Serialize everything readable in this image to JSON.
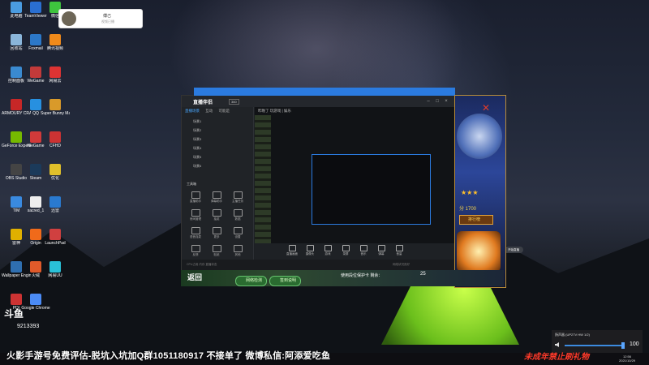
{
  "notification": {
    "name": "傅己",
    "sub": "视频已播"
  },
  "desktop_icons": [
    {
      "label": "此电脑",
      "color": "#4a9be0"
    },
    {
      "label": "TeamViewer",
      "color": "#2a6fd1"
    },
    {
      "label": "微信",
      "color": "#3ec43e"
    },
    {
      "label": "回收站",
      "color": "#8ab5d9"
    },
    {
      "label": "Foxmail",
      "color": "#2c78c8"
    },
    {
      "label": "腾讯视频",
      "color": "#f08a1a"
    },
    {
      "label": "控制面板",
      "color": "#3a8ad0"
    },
    {
      "label": "WeGame",
      "color": "#c23a3a"
    },
    {
      "label": "网易云",
      "color": "#d33"
    },
    {
      "label": "ARMOURY CRATE",
      "color": "#c72727"
    },
    {
      "label": "QQ",
      "color": "#2790e0"
    },
    {
      "label": "Super Bunny Man",
      "color": "#d99a2a"
    },
    {
      "label": "GeForce Experience",
      "color": "#76b900"
    },
    {
      "label": "WeGame",
      "color": "#d13a3a"
    },
    {
      "label": "CFHD",
      "color": "#c33"
    },
    {
      "label": "OBS Studio",
      "color": "#444"
    },
    {
      "label": "Steam",
      "color": "#1b3a5a"
    },
    {
      "label": "优化",
      "color": "#e0c02a"
    },
    {
      "label": "TIM",
      "color": "#3a8ae0"
    },
    {
      "label": "sacred_1",
      "color": "#eee"
    },
    {
      "label": "迅雷",
      "color": "#2a7ad0"
    },
    {
      "label": "雷神",
      "color": "#e0b000"
    },
    {
      "label": "Origin",
      "color": "#f06a1a"
    },
    {
      "label": "LaunchPad",
      "color": "#d04040"
    },
    {
      "label": "Wallpaper Engine",
      "color": "#2f6fb0"
    },
    {
      "label": "火绒",
      "color": "#e05a2a"
    },
    {
      "label": "网易UU",
      "color": "#2ac1d8"
    },
    {
      "label": "PDI",
      "color": "#c33"
    },
    {
      "label": "Google Chrome",
      "color": "#4b8bf5"
    }
  ],
  "streamer": {
    "app_title": "直播伴侣",
    "version_badge": "360",
    "tabs": [
      "直播场景",
      "互动",
      "可能是"
    ],
    "active_tab": "直播场景",
    "scene_rows": [
      "场景1",
      "场景2",
      "场景3",
      "场景4",
      "场景5",
      "场景6"
    ],
    "tools_title": "工具箱",
    "tools": [
      "直播助手",
      "弹幕助手",
      "主播任务",
      "房间管理",
      "抽奖",
      "数据",
      "语音连麦",
      "更多",
      "设置",
      "反馈",
      "贴纸",
      "其他"
    ],
    "preview_header": "昨晚了 玩游戏 |  娱乐",
    "toolbar": [
      "直播画面",
      "摄像头",
      "游戏",
      "录屏",
      "音乐",
      "弹幕",
      "音量"
    ],
    "start_label": "开始直播",
    "status_left": "CPU占用 内存 直播状态",
    "status_right": "网络状况良好"
  },
  "game": {
    "stars": "★★★",
    "score_label": "分 1700",
    "rank_label": "排行榜",
    "back_label": "返回",
    "btn1": "网络检测",
    "btn2": "签到说明",
    "protect_text": "使用段位保护卡   剩余：",
    "protect_count": "25"
  },
  "douyu": {
    "logo": "斗鱼",
    "room_id": "9213393"
  },
  "volume": {
    "device": "扬声器 (UP27V HW 1/2)",
    "value": "100"
  },
  "ticker": "火影手游号免费评估-脱坑入坑加Q群1051180917 不接单了 微博私信:阿添爱吃鱼",
  "warning": "未成年禁止刷礼物",
  "clock": {
    "time": "12:56",
    "date": "2021/10/29"
  }
}
